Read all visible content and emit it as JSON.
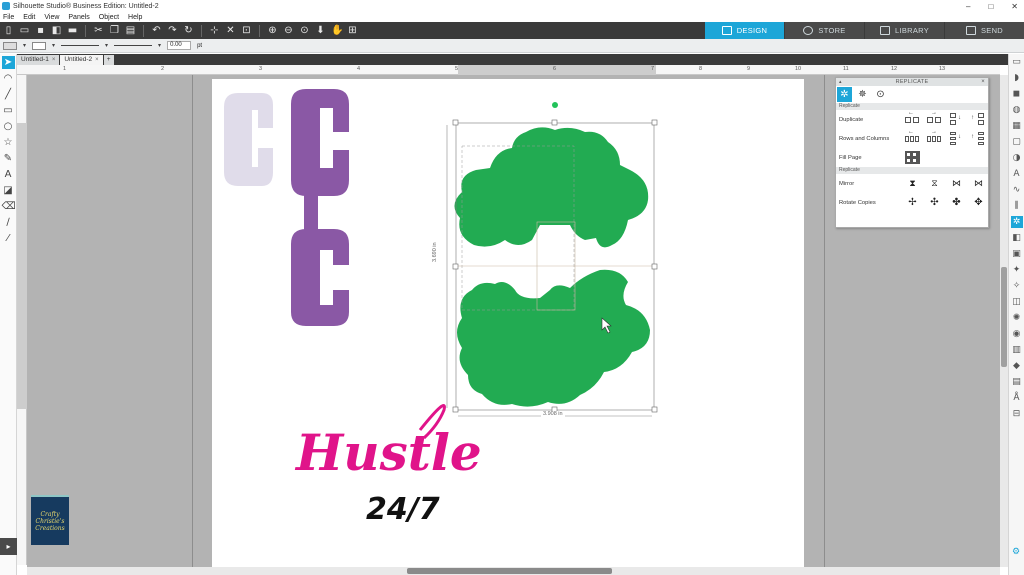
{
  "window": {
    "title": "Silhouette Studio® Business Edition: Untitled-2",
    "controls": [
      "–",
      "□",
      "✕"
    ]
  },
  "menu": [
    "File",
    "Edit",
    "View",
    "Panels",
    "Object",
    "Help"
  ],
  "nav_tabs": [
    {
      "label": "DESIGN",
      "active": true
    },
    {
      "label": "STORE",
      "active": false
    },
    {
      "label": "LIBRARY",
      "active": false
    },
    {
      "label": "SEND",
      "active": false
    }
  ],
  "properties": {
    "line_width_value": "0.00",
    "line_width_unit": "pt"
  },
  "doc_tabs": [
    {
      "label": "Untitled-1",
      "active": false
    },
    {
      "label": "Untitled-2",
      "active": true
    }
  ],
  "ruler_top_ticks": [
    "1",
    "2",
    "3",
    "4",
    "5",
    "6",
    "7",
    "8",
    "9",
    "10",
    "11",
    "12",
    "13"
  ],
  "canvas": {
    "width_measure": "3.908 in",
    "height_measure": "3.690 in",
    "hustle_text": "Hustle",
    "hustle_sub": "24/7",
    "colors": {
      "purple_c": "#8a58a5",
      "light_c": "#e0dcea",
      "green_shape": "#22ab52",
      "hustle_pink": "#e0148a",
      "accent": "#1da6d8"
    }
  },
  "replicate_panel": {
    "title": "REPLICATE",
    "section1": "Replicate",
    "section2": "Replicate",
    "rows": [
      {
        "label": "Duplicate"
      },
      {
        "label": "Rows and Columns"
      },
      {
        "label": "Fill Page"
      },
      {
        "label": "Mirror"
      },
      {
        "label": "Rotate Copies"
      }
    ]
  },
  "branding": {
    "text": "Crafty\nChristie's\nCreations"
  }
}
